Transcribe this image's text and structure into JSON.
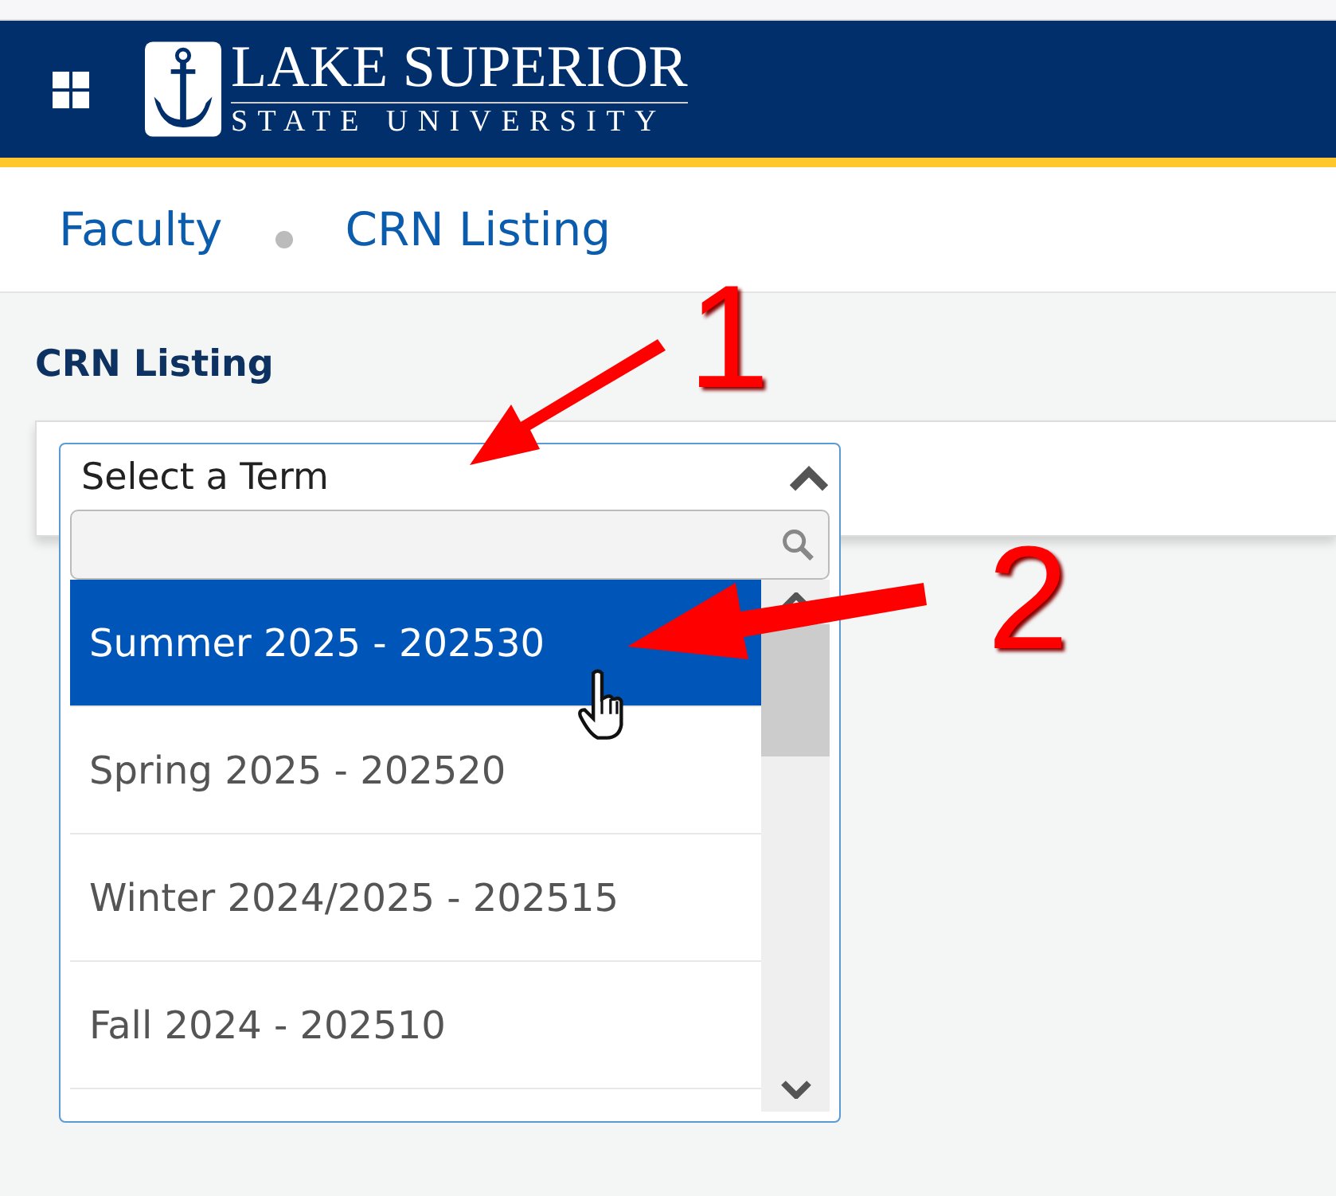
{
  "header": {
    "logo": {
      "line_1": "LAKE SUPERIOR",
      "line_2": "STATE UNIVERSITY"
    }
  },
  "breadcrumbs": [
    {
      "label": "Faculty"
    },
    {
      "label": "CRN Listing"
    }
  ],
  "page_title": "CRN Listing",
  "term_select": {
    "value": "Select a Term",
    "expanded": true,
    "options": [
      {
        "label": "Summer 2025 - 202530",
        "selected": true
      },
      {
        "label": "Spring 2025 - 202520",
        "selected": false
      },
      {
        "label": "Winter 2024/2025 - 202515",
        "selected": false
      },
      {
        "label": "Fall 2024 - 202510",
        "selected": false
      }
    ]
  },
  "annotations": [
    {
      "label": "1"
    },
    {
      "label": "2"
    }
  ]
}
